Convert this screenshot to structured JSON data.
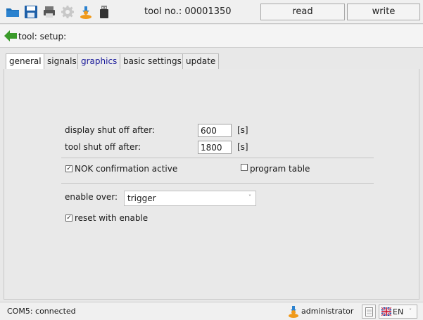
{
  "header": {
    "tool_number_label": "tool no.: 00001350",
    "read_label": "read",
    "write_label": "write",
    "icons": [
      "open-folder-icon",
      "save-disk-icon",
      "print-icon",
      "settings-gear-icon",
      "user-transfer-icon",
      "usb-stick-icon"
    ]
  },
  "path": {
    "label": "tool: setup:",
    "back_icon": "back-arrow-icon"
  },
  "tabs": [
    {
      "label": "general",
      "active": true
    },
    {
      "label": "signals",
      "active": false
    },
    {
      "label": "graphics",
      "active": false
    },
    {
      "label": "basic settings",
      "active": false
    },
    {
      "label": "update",
      "active": false
    }
  ],
  "general": {
    "display_shutoff_label": "display shut off after:",
    "display_shutoff_value": "600",
    "display_shutoff_unit": "[s]",
    "tool_shutoff_label": "tool shut off after:",
    "tool_shutoff_value": "1800",
    "tool_shutoff_unit": "[s]",
    "nok_confirmation_label": "NOK confirmation active",
    "nok_confirmation_checked": true,
    "program_table_label": "program table",
    "program_table_checked": false,
    "enable_over_label": "enable over:",
    "enable_over_value": "trigger",
    "reset_with_enable_label": "reset with enable",
    "reset_with_enable_checked": true
  },
  "status": {
    "connection": "COM5: connected",
    "user": "administrator",
    "language": "EN"
  },
  "colors": {
    "folder": "#1d6fb8",
    "accent_orange": "#f09a1a",
    "back_arrow": "#3a9a2a",
    "tab_blue_text": "#1a1a9a"
  }
}
